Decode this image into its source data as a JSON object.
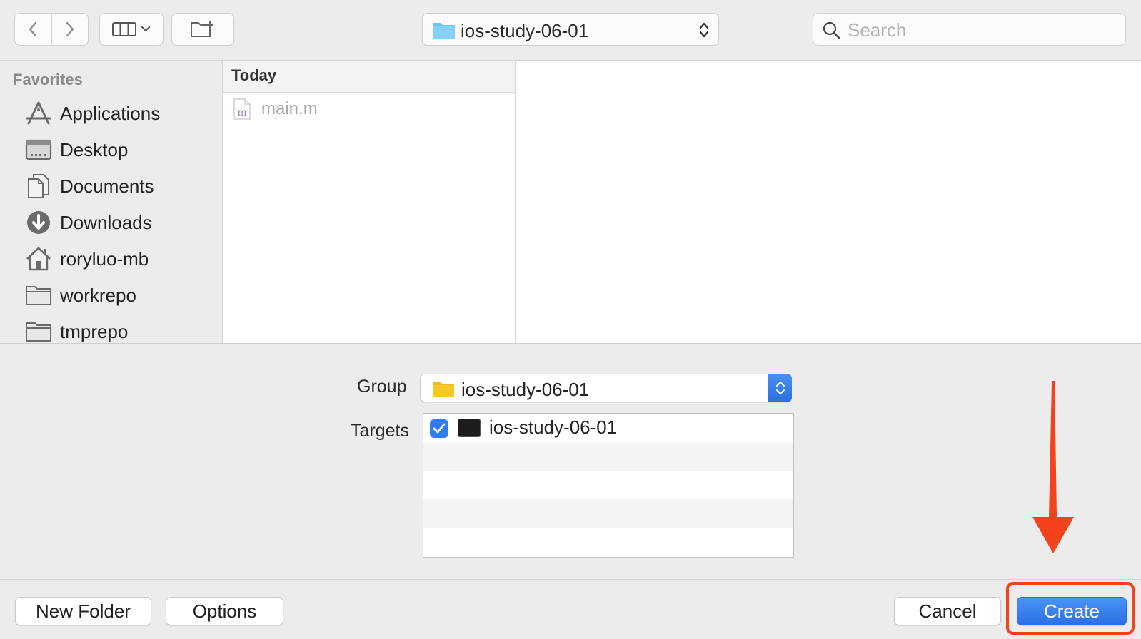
{
  "toolbar": {
    "path_popup": "ios-study-06-01",
    "search_placeholder": "Search"
  },
  "sidebar": {
    "heading": "Favorites",
    "items": [
      {
        "label": "Applications",
        "icon": "applications-icon"
      },
      {
        "label": "Desktop",
        "icon": "desktop-icon"
      },
      {
        "label": "Documents",
        "icon": "documents-icon"
      },
      {
        "label": "Downloads",
        "icon": "downloads-icon"
      },
      {
        "label": "roryluo-mb",
        "icon": "home-icon"
      },
      {
        "label": "workrepo",
        "icon": "folder-icon"
      },
      {
        "label": "tmprepo",
        "icon": "folder-icon"
      }
    ]
  },
  "browser": {
    "column_header": "Today",
    "files": [
      {
        "name": "main.m",
        "icon_glyph": "m"
      }
    ]
  },
  "options": {
    "group_label": "Group",
    "group_value": "ios-study-06-01",
    "targets_label": "Targets",
    "targets": [
      {
        "name": "ios-study-06-01",
        "checked": true
      }
    ]
  },
  "footer": {
    "new_folder": "New Folder",
    "options": "Options",
    "cancel": "Cancel",
    "create": "Create"
  },
  "colors": {
    "accent": "#2f7cf6",
    "annotation": "#f4431c",
    "folder_blue": "#6cc4f7",
    "folder_yellow": "#f7c62a"
  }
}
